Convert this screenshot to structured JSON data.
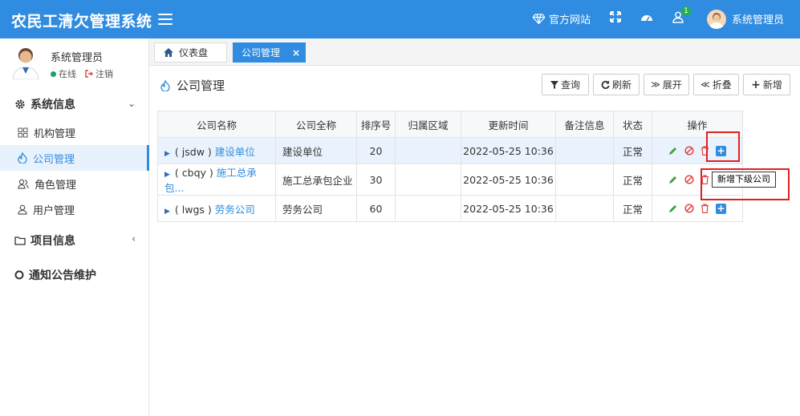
{
  "app": {
    "title": "农民工清欠管理系统"
  },
  "header": {
    "official_site": "官方网站",
    "notification_count": "1",
    "user_name": "系统管理员"
  },
  "sidebar": {
    "user": {
      "name": "系统管理员",
      "status_online": "在线",
      "logout": "注销"
    },
    "groups": [
      {
        "label": "系统信息",
        "items": [
          {
            "label": "机构管理"
          },
          {
            "label": "公司管理"
          },
          {
            "label": "角色管理"
          },
          {
            "label": "用户管理"
          }
        ]
      },
      {
        "label": "项目信息"
      },
      {
        "label": "通知公告维护"
      }
    ]
  },
  "tabs": [
    {
      "label": "仪表盘"
    },
    {
      "label": "公司管理",
      "close": "×"
    }
  ],
  "page": {
    "title": "公司管理",
    "buttons": {
      "query": "查询",
      "refresh": "刷新",
      "expand": "展开",
      "collapse": "折叠",
      "add": "新增"
    }
  },
  "table": {
    "headers": [
      "公司名称",
      "公司全称",
      "排序号",
      "归属区域",
      "更新时间",
      "备注信息",
      "状态",
      "操作"
    ],
    "rows": [
      {
        "code": "( jsdw )",
        "name": "建设单位",
        "full_name": "建设单位",
        "sort": "20",
        "region": "",
        "updated": "2022-05-25 10:36",
        "remark": "",
        "status": "正常"
      },
      {
        "code": "( cbqy )",
        "name": "施工总承包...",
        "full_name": "施工总承包企业",
        "sort": "30",
        "region": "",
        "updated": "2022-05-25 10:36",
        "remark": "",
        "status": "正常"
      },
      {
        "code": "( lwgs )",
        "name": "劳务公司",
        "full_name": "劳务公司",
        "sort": "60",
        "region": "",
        "updated": "2022-05-25 10:36",
        "remark": "",
        "status": "正常"
      }
    ]
  },
  "tooltip": {
    "text": "新增下级公司"
  },
  "colors": {
    "primary": "#2f8ce0",
    "highlight": "#e02020",
    "online": "#1aa260"
  }
}
